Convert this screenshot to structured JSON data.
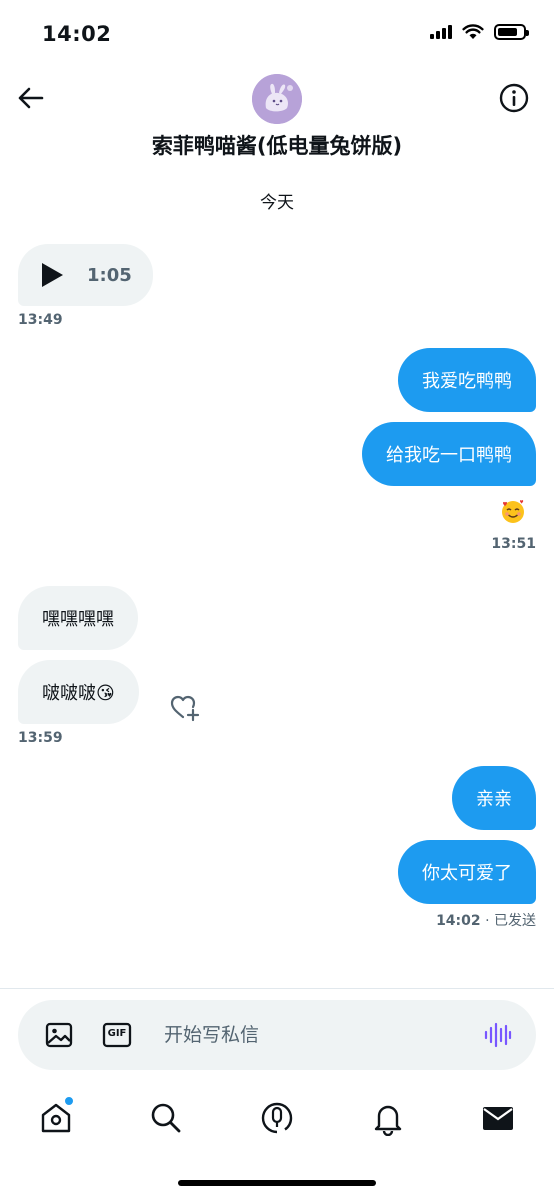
{
  "status_bar": {
    "time": "14:02",
    "battery_level": 0.8
  },
  "header": {
    "title": "索菲鸭喵酱(低电量兔饼版)",
    "back_icon": "arrow-left-icon",
    "info_icon": "info-icon"
  },
  "date_separator": "今天",
  "messages": {
    "voice": {
      "duration": "1:05",
      "time": "13:49"
    },
    "out1": {
      "text": "我爱吃鸭鸭"
    },
    "out2": {
      "text": "给我吃一口鸭鸭",
      "reaction": "🥰",
      "time": "13:51"
    },
    "in1": {
      "text": "嘿嘿嘿嘿"
    },
    "in2": {
      "text": "啵啵啵😘",
      "time": "13:59"
    },
    "out3": {
      "text": "亲亲"
    },
    "out4": {
      "text": "你太可爱了",
      "time": "14:02",
      "status": " · 已发送"
    }
  },
  "composer": {
    "placeholder": "开始写私信",
    "gif_label": "GIF"
  },
  "nav": {
    "items": [
      "home-icon",
      "search-icon",
      "spaces-icon",
      "bell-icon",
      "mail-icon"
    ],
    "home_has_badge": true
  },
  "colors": {
    "accent": "#1d9bf0",
    "incoming_bubble": "#eff3f4",
    "muted_text": "#536471",
    "voice_purple": "#7856ff"
  }
}
